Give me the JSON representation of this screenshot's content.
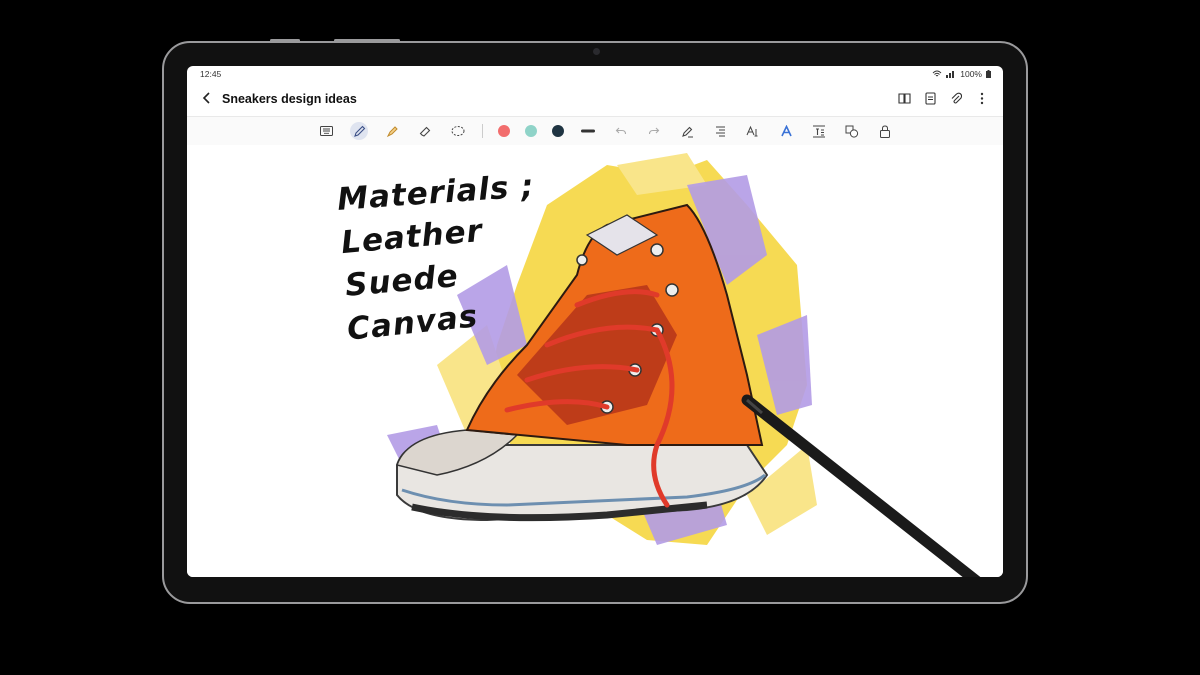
{
  "status": {
    "time": "12:45",
    "battery": "100%"
  },
  "note": {
    "title": "Sneakers design ideas"
  },
  "toolbar": {
    "tools": [
      "keyboard-icon",
      "pen-icon",
      "highlighter-icon",
      "eraser-icon",
      "lasso-icon"
    ],
    "colors": [
      "#f26d6d",
      "#8fd3c8",
      "#1f3442"
    ],
    "actions": [
      "undo-icon",
      "redo-icon",
      "pen-settings-icon",
      "text-convert-icon",
      "text-style-icon",
      "handwriting-icon",
      "text-box-icon",
      "shapes-icon",
      "lock-icon"
    ]
  },
  "appbar": {
    "actions": [
      "book-view-icon",
      "page-icon",
      "attach-icon",
      "more-icon"
    ]
  },
  "handwriting": [
    "Materials ;",
    "Leather",
    "Suede",
    "Canvas"
  ]
}
